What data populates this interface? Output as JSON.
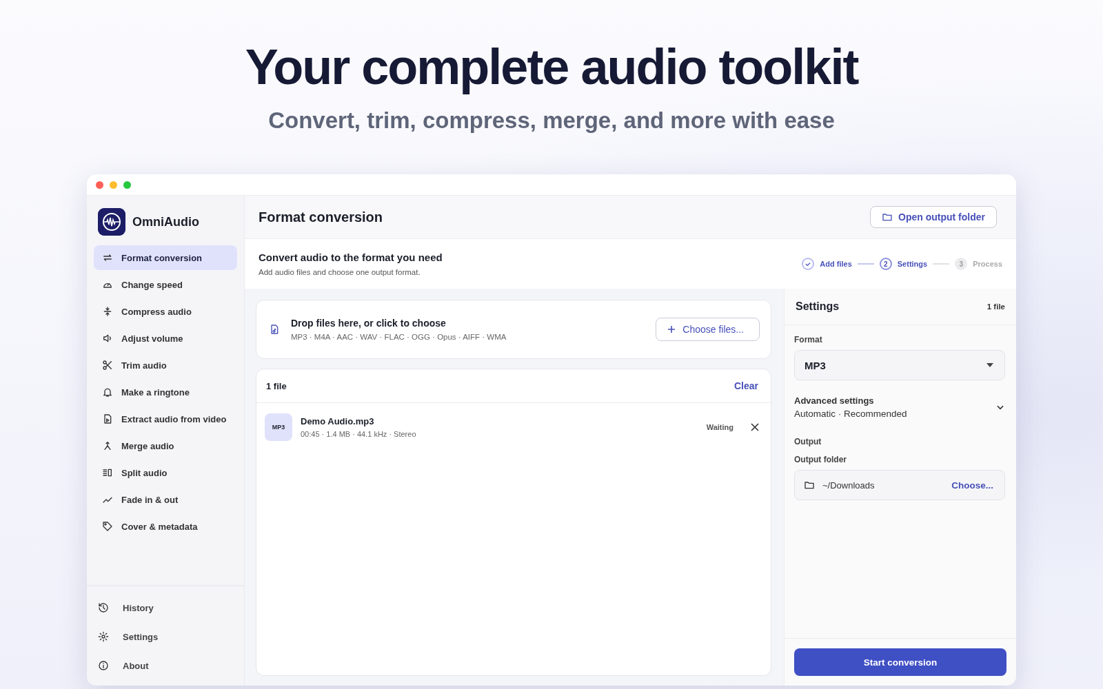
{
  "hero": {
    "title": "Your complete audio toolkit",
    "subtitle": "Convert, trim, compress, merge, and more with ease"
  },
  "app": {
    "name": "OmniAudio"
  },
  "sidebar": {
    "items": [
      {
        "label": "Format conversion",
        "selected": true
      },
      {
        "label": "Change speed",
        "selected": false
      },
      {
        "label": "Compress audio",
        "selected": false
      },
      {
        "label": "Adjust volume",
        "selected": false
      },
      {
        "label": "Trim audio",
        "selected": false
      },
      {
        "label": "Make a ringtone",
        "selected": false
      },
      {
        "label": "Extract audio from video",
        "selected": false
      },
      {
        "label": "Merge audio",
        "selected": false
      },
      {
        "label": "Split audio",
        "selected": false
      },
      {
        "label": "Fade in & out",
        "selected": false
      },
      {
        "label": "Cover & metadata",
        "selected": false
      }
    ],
    "footer": [
      {
        "label": "History"
      },
      {
        "label": "Settings"
      },
      {
        "label": "About"
      }
    ]
  },
  "header": {
    "title": "Format conversion",
    "button": "Open output folder"
  },
  "intro": {
    "title": "Convert audio to the format you need",
    "subtitle": "Add audio files and choose one output format."
  },
  "steps": [
    {
      "kind": "done",
      "label": "Add files"
    },
    {
      "kind": "current",
      "number": "2",
      "label": "Settings"
    },
    {
      "kind": "upcoming",
      "number": "3",
      "label": "Process"
    }
  ],
  "dropzone": {
    "title": "Drop files here, or click to choose",
    "formats": "MP3 · M4A · AAC · WAV · FLAC · OGG · Opus · AIFF · WMA",
    "button": "Choose files..."
  },
  "files": {
    "count": "1 file",
    "clear": "Clear",
    "items": [
      {
        "badge": "MP3",
        "name": "Demo Audio.mp3",
        "meta": "00:45 · 1.4 MB · 44.1 kHz · Stereo",
        "status": "Waiting"
      }
    ]
  },
  "settings": {
    "title": "Settings",
    "count": "1 file",
    "format_label": "Format",
    "format_value": "MP3",
    "advanced_title": "Advanced settings",
    "advanced_value": "Automatic · Recommended",
    "output_label": "Output",
    "folder_label": "Output folder",
    "folder_value": "~/Downloads",
    "folder_button": "Choose...",
    "start_button": "Start conversion"
  }
}
